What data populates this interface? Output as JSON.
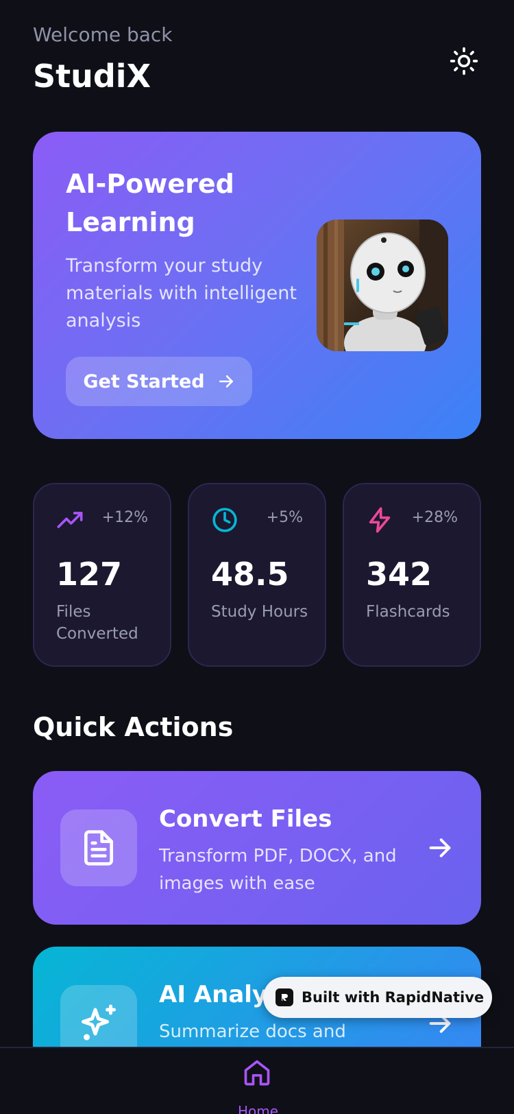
{
  "header": {
    "welcome": "Welcome back",
    "title": "StudiX",
    "theme_icon": "sun-icon"
  },
  "hero": {
    "title": "AI-Powered Learning",
    "description": "Transform your study materials with intelligent analysis",
    "button_label": "Get Started",
    "button_icon": "arrow-right-icon",
    "image": "robot-photo"
  },
  "stats": [
    {
      "icon": "trending-up-icon",
      "color": "#a855f7",
      "change": "+12%",
      "value": "127",
      "label": "Files Converted"
    },
    {
      "icon": "clock-icon",
      "color": "#06b6d4",
      "change": "+5%",
      "value": "48.5",
      "label": "Study Hours"
    },
    {
      "icon": "zap-icon",
      "color": "#ec4899",
      "change": "+28%",
      "value": "342",
      "label": "Flashcards"
    }
  ],
  "quick_actions": {
    "title": "Quick Actions",
    "items": [
      {
        "title": "Convert Files",
        "description": "Transform PDF, DOCX, and images with ease",
        "icon": "file-text-icon",
        "arrow_icon": "arrow-right-icon"
      },
      {
        "title": "AI Analyz",
        "description": "Summarize docs and",
        "icon": "sparkles-icon",
        "arrow_icon": "arrow-right-icon"
      }
    ]
  },
  "badge": {
    "text": "Built with RapidNative"
  },
  "tab_bar": {
    "items": [
      {
        "label": "Home",
        "icon": "home-icon",
        "active": true,
        "color": "#a855f7"
      }
    ]
  },
  "colors": {
    "background": "#0f0f17",
    "accent_purple": "#8b5cf6",
    "accent_blue": "#3b82f6",
    "accent_cyan": "#06b6d4",
    "accent_pink": "#ec4899"
  }
}
